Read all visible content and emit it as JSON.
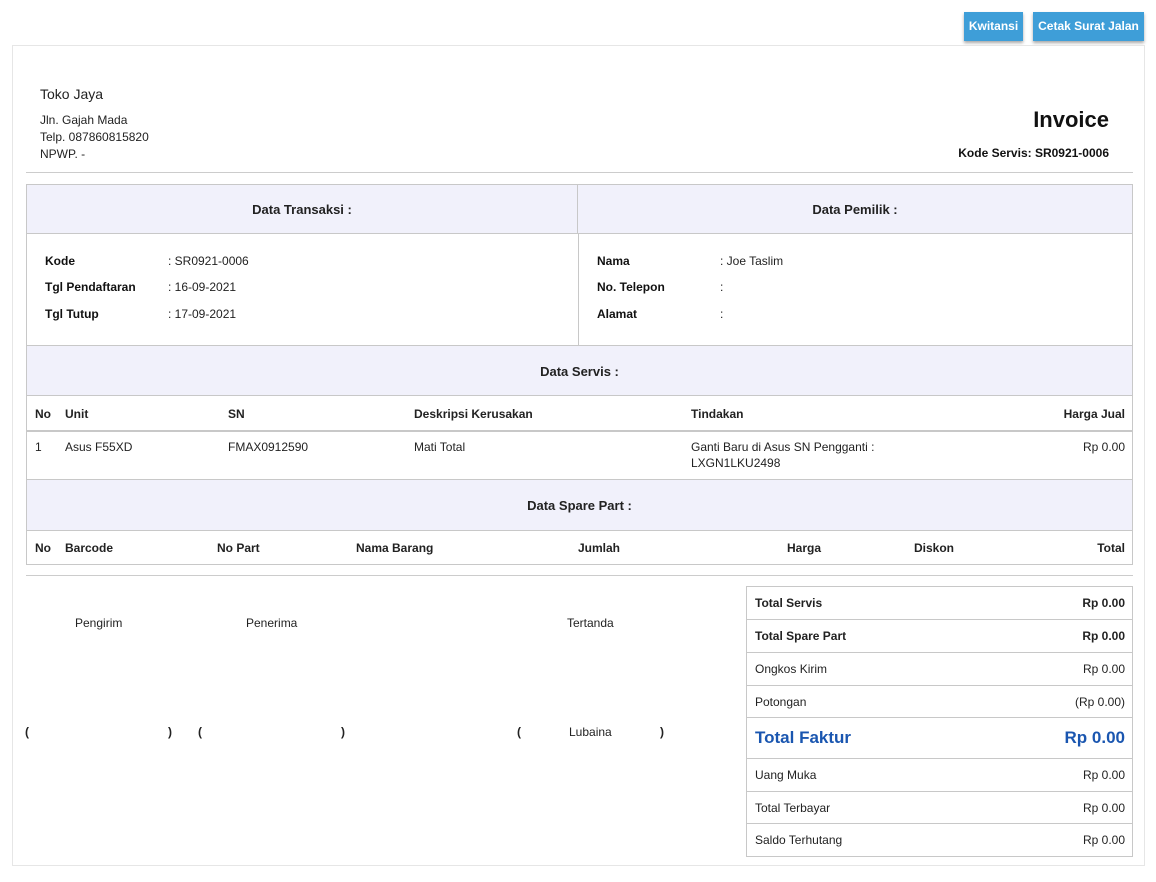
{
  "actions": {
    "kwitansi_label": "Kwitansi",
    "surat_jalan_label": "Cetak Surat Jalan"
  },
  "company": {
    "name": "Toko Jaya",
    "address": "Jln. Gajah Mada",
    "phone": "Telp. 087860815820",
    "npwp": "NPWP. -"
  },
  "invoice": {
    "title": "Invoice",
    "code_line": "Kode Servis: SR0921-0006"
  },
  "transaksi": {
    "title": "Data Transaksi :",
    "rows": [
      {
        "label": "Kode",
        "value": ": SR0921-0006"
      },
      {
        "label": "Tgl Pendaftaran",
        "value": ": 16-09-2021"
      },
      {
        "label": "Tgl Tutup",
        "value": ": 17-09-2021"
      }
    ]
  },
  "pemilik": {
    "title": "Data Pemilik :",
    "rows": [
      {
        "label": "Nama",
        "value": ": Joe Taslim"
      },
      {
        "label": "No. Telepon",
        "value": ":"
      },
      {
        "label": "Alamat",
        "value": ":"
      }
    ]
  },
  "servis": {
    "title": "Data Servis :",
    "headers": {
      "no": "No",
      "unit": "Unit",
      "sn": "SN",
      "deskripsi": "Deskripsi Kerusakan",
      "tindakan": "Tindakan",
      "harga": "Harga Jual"
    },
    "rows": [
      {
        "no": "1",
        "unit": "Asus F55XD",
        "sn": "FMAX0912590",
        "deskripsi": "Mati Total",
        "tindakan_1": "Ganti Baru di Asus SN Pengganti :",
        "tindakan_2": "LXGN1LKU2498",
        "harga": "Rp 0.00"
      }
    ]
  },
  "sparepart": {
    "title": "Data Spare Part :",
    "headers": {
      "no": "No",
      "barcode": "Barcode",
      "nopart": "No Part",
      "nama": "Nama Barang",
      "jumlah": "Jumlah",
      "harga": "Harga",
      "diskon": "Diskon",
      "total": "Total"
    }
  },
  "signatures": {
    "pengirim": "Pengirim",
    "penerima": "Penerima",
    "tertanda": "Tertanda",
    "open": "(",
    "close": ")",
    "tertanda_name": "Lubaina"
  },
  "summary": [
    {
      "label": "Total Servis",
      "value": "Rp 0.00",
      "style": "bold"
    },
    {
      "label": "Total Spare Part",
      "value": "Rp 0.00",
      "style": "bold"
    },
    {
      "label": "Ongkos Kirim",
      "value": "Rp 0.00",
      "style": ""
    },
    {
      "label": "Potongan",
      "value": "(Rp 0.00)",
      "style": ""
    },
    {
      "label": "Total Faktur",
      "value": "Rp 0.00",
      "style": "big"
    },
    {
      "label": "Uang Muka",
      "value": "Rp 0.00",
      "style": ""
    },
    {
      "label": "Total Terbayar",
      "value": "Rp 0.00",
      "style": ""
    },
    {
      "label": "Saldo Terhutang",
      "value": "Rp 0.00",
      "style": ""
    }
  ]
}
